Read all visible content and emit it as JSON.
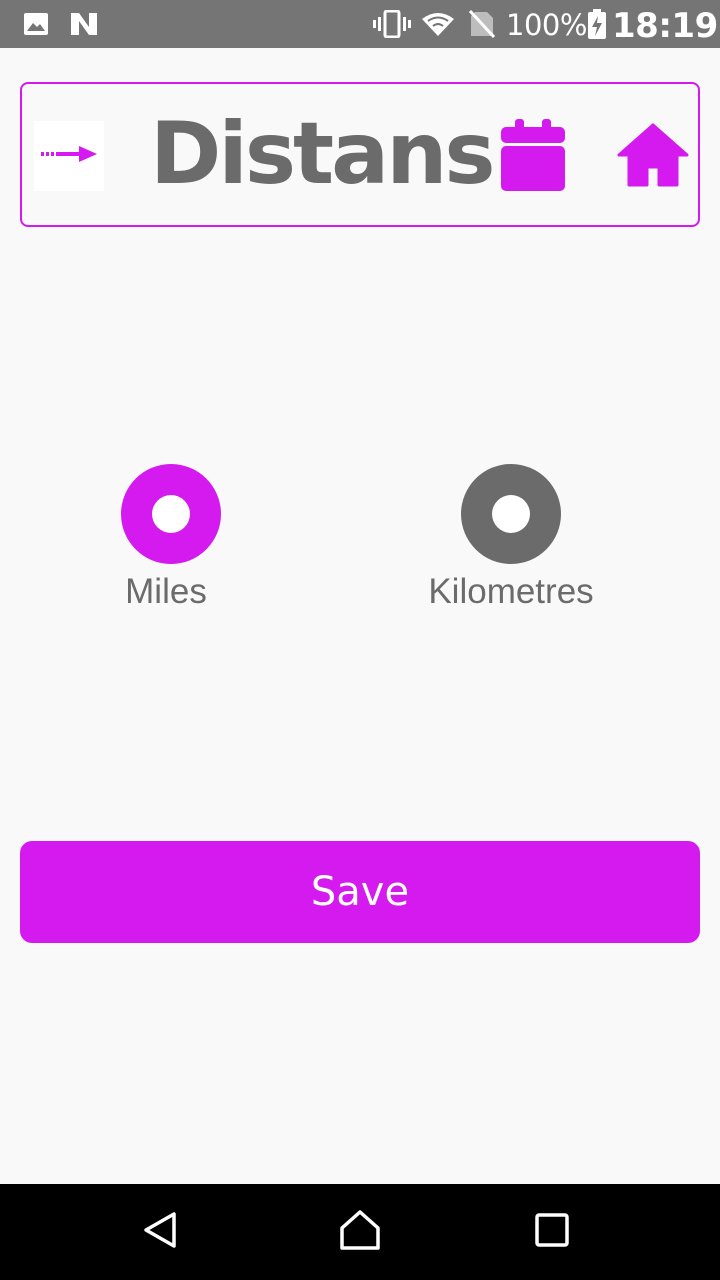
{
  "status_bar": {
    "icons": [
      "image-icon",
      "n-notification-icon",
      "vibrate-icon",
      "wifi-icon",
      "no-sim-icon",
      "battery-charging-icon"
    ],
    "battery": "100%",
    "time": "18:19"
  },
  "header": {
    "title": "Distans",
    "back_icon": "arrow-right-icon",
    "calendar_icon": "calendar-icon",
    "home_icon": "home-icon"
  },
  "units": {
    "options": [
      {
        "label": "Miles",
        "selected": true
      },
      {
        "label": "Kilometres",
        "selected": false
      }
    ]
  },
  "actions": {
    "save_label": "Save"
  },
  "nav_bar": {
    "buttons": [
      "back-triangle-icon",
      "home-outline-icon",
      "recents-square-icon"
    ]
  },
  "colors": {
    "accent": "#d41aee",
    "muted": "#6b6b6b",
    "background": "#f9f9f9",
    "status_bar": "#757575",
    "nav_bar": "#000000"
  }
}
